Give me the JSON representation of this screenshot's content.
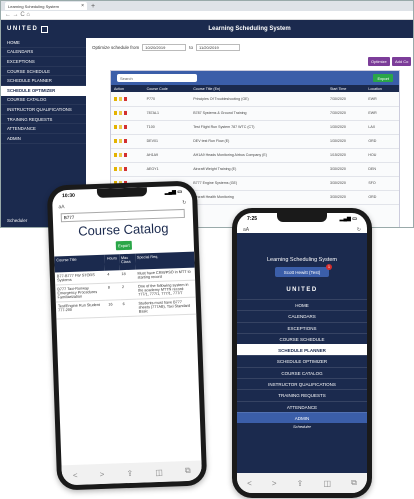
{
  "browser": {
    "tab_title": "Learning Scheduling System",
    "tab_close": "×",
    "new_tab": "+",
    "nav_icons": "← → C ⌂"
  },
  "app": {
    "brand": "UNITED",
    "header_title": "Learning Scheduling System",
    "footer_label": "Scheduler",
    "sidebar_items": [
      {
        "label": "HOME"
      },
      {
        "label": "CALENDARS"
      },
      {
        "label": "EXCEPTIONS"
      },
      {
        "label": "COURSE SCHEDULE"
      },
      {
        "label": "SCHEDULE PLANNER"
      },
      {
        "label": "SCHEDULE OPTIMIZER",
        "active": true
      },
      {
        "label": "COURSE CATALOG"
      },
      {
        "label": "INSTRUCTOR QUALIFICATIONS"
      },
      {
        "label": "TRAINING REQUESTS"
      },
      {
        "label": "ATTENDANCE"
      },
      {
        "label": "ADMIN"
      }
    ],
    "optimize": {
      "label": "Optimize schedule from",
      "from": "10/20/2019",
      "to_label": "to",
      "to": "11/20/2019",
      "optimize_btn": "Optimize",
      "add_btn": "Add Co"
    },
    "table": {
      "search_placeholder": "Search",
      "export_label": "Export",
      "headers": [
        "Action",
        "Course Code",
        "Course Title (En)",
        "Start Time",
        "Location"
      ],
      "rows": [
        [
          "",
          "P770",
          "Principles Of Troubleshooting (GE)",
          "7/30/2020",
          "EWR"
        ],
        [
          "",
          "787AL1",
          "B787 Systems & Ground Training",
          "7/30/2020",
          "EWR"
        ],
        [
          "",
          "T100",
          "Test Flight Run System 787 WTC (CT)",
          "1/30/2020",
          "LAX"
        ],
        [
          "",
          "DEV01",
          "DEV test Run Flow (E)",
          "1/30/2020",
          "ORD"
        ],
        [
          "",
          "AH1A9",
          "AH1A9 Heads Monitoring Airbus Company (E)",
          "1/15/2020",
          "HOU"
        ],
        [
          "",
          "AEGY1",
          "Aircraft Weight Training (E)",
          "3/30/2020",
          "DEN"
        ],
        [
          "",
          "",
          "B777 Engine Systems (GE)",
          "3/30/2020",
          "SFO"
        ],
        [
          "",
          "",
          "Aircraft Health Monitoring",
          "3/30/2020",
          "ORD"
        ]
      ]
    }
  },
  "phone1": {
    "time": "10:30",
    "signal": "▂▄▆ ▭",
    "url_left": "aA",
    "url_right": "↻",
    "search_value": "B777",
    "title": "Course Catalog",
    "export_label": "Export",
    "headers": [
      "Course Title",
      "Hours",
      "Max Class",
      "Special Req."
    ],
    "rows": [
      [
        "B77-B777 FW STORS Systems",
        "4",
        "18",
        "Must have CRM/PSO in MTT to starting record"
      ],
      [
        "B777 Taxi-Runway Emergency Procedures Familiarization",
        "8",
        "2",
        "One of the following system in the academy MTTN record: 777/1, 777/1, 777/1, 777/7"
      ],
      [
        "Test/Engine Run Student 777-200",
        "16",
        "6",
        "Students must have B777 sheets (777AB), Taxi Standard Basic"
      ]
    ],
    "bottom_icons": [
      "<",
      ">",
      "⇪",
      "◫",
      "⧉"
    ]
  },
  "phone2": {
    "time": "7:25",
    "signal": "▂▄▆ ▭",
    "url_left": "aA",
    "url_right": "↻",
    "title": "Learning Scheduling System",
    "user": "Scott Hewitt (Test)",
    "badge": "1",
    "brand": "UNITED",
    "nav": [
      {
        "label": "HOME"
      },
      {
        "label": "CALENDARS"
      },
      {
        "label": "EXCEPTIONS"
      },
      {
        "label": "COURSE SCHEDULE"
      },
      {
        "label": "SCHEDULE PLANNER",
        "active": true
      },
      {
        "label": "SCHEDULE OPTIMIZER"
      },
      {
        "label": "COURSE CATALOG"
      },
      {
        "label": "INSTRUCTOR QUALIFICATIONS"
      },
      {
        "label": "TRAINING REQUESTS"
      },
      {
        "label": "ATTENDANCE"
      },
      {
        "label": "ADMIN",
        "admin": true
      }
    ],
    "footer_label": "Scheduler",
    "bottom_icons": [
      "<",
      ">",
      "⇪",
      "◫",
      "⧉"
    ]
  },
  "colors": {
    "navy": "#1b2a4e",
    "blue": "#3b5ea9",
    "green": "#2aa648",
    "purple": "#7c3d99",
    "red": "#d32f2f"
  }
}
